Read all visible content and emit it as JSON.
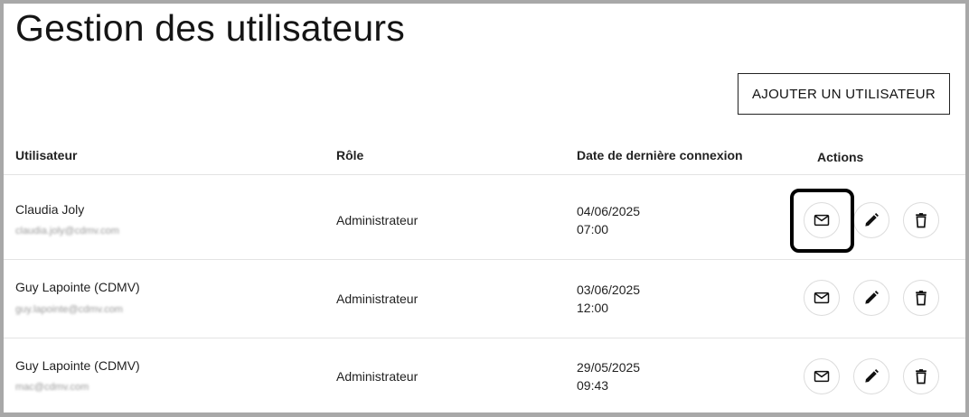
{
  "page": {
    "title": "Gestion des utilisateurs"
  },
  "toolbar": {
    "add_user_label": "AJOUTER UN UTILISATEUR"
  },
  "table": {
    "headers": {
      "user": "Utilisateur",
      "role": "Rôle",
      "last_login": "Date de dernière connexion",
      "actions": "Actions"
    },
    "rows": [
      {
        "name": "Claudia Joly",
        "email": "claudia.joly@cdmv.com",
        "role": "Administrateur",
        "date": "04/06/2025",
        "time": "07:00"
      },
      {
        "name": "Guy Lapointe (CDMV)",
        "email": "guy.lapointe@cdmv.com",
        "role": "Administrateur",
        "date": "03/06/2025",
        "time": "12:00"
      },
      {
        "name": "Guy Lapointe (CDMV)",
        "email": "mac@cdmv.com",
        "role": "Administrateur",
        "date": "29/05/2025",
        "time": "09:43"
      }
    ],
    "action_icons": [
      "mail-icon",
      "pencil-icon",
      "trash-icon"
    ]
  },
  "colors": {
    "frame_border": "#a8a8a8",
    "focus_ring": "#000000",
    "divider": "#e3e3e3"
  }
}
